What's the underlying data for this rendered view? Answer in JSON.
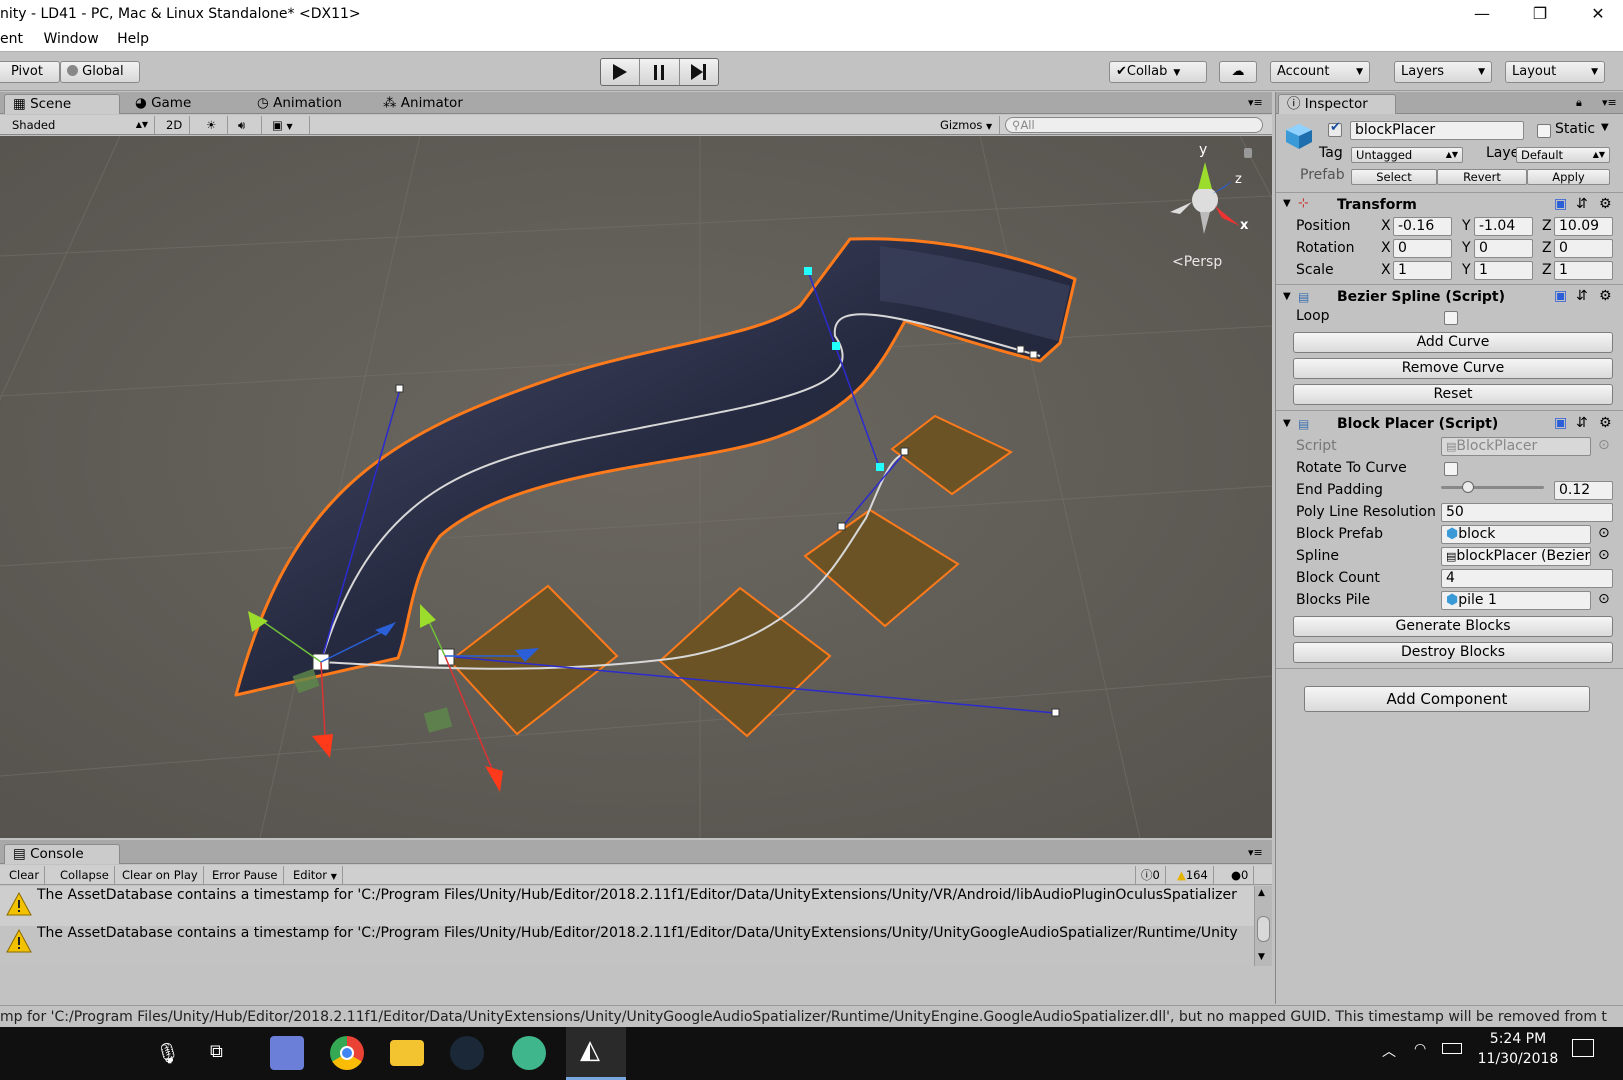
{
  "window": {
    "title": "nity - LD41 - PC, Mac & Linux Standalone* <DX11>",
    "minimize_glyph": "—",
    "maximize_glyph": "❐",
    "close_glyph": "✕"
  },
  "menu": [
    "ent",
    "Window",
    "Help"
  ],
  "toolbar": {
    "pivot": "Pivot",
    "global": "Global",
    "collab": "Collab",
    "account": "Account",
    "layers": "Layers",
    "layout": "Layout"
  },
  "scene_tabs": [
    {
      "label": "Scene",
      "icon": "grid-icon"
    },
    {
      "label": "Game",
      "icon": "game-icon"
    },
    {
      "label": "Animation",
      "icon": "clock-icon"
    },
    {
      "label": "Animator",
      "icon": "animator-icon"
    }
  ],
  "scene_toolbar": {
    "shading": "Shaded",
    "mode_2d": "2D",
    "gizmos": "Gizmos",
    "search_placeholder": "All"
  },
  "scene": {
    "gizmo_y": "y",
    "gizmo_z": "z",
    "gizmo_x": "x",
    "persp": "Persp"
  },
  "console": {
    "tab": "Console",
    "clear": "Clear",
    "collapse": "Collapse",
    "clear_on_play": "Clear on Play",
    "error_pause": "Error Pause",
    "editor": "Editor",
    "info_count": "0",
    "warn_count": "164",
    "error_count": "0",
    "logs": [
      "The AssetDatabase contains a timestamp for 'C:/Program Files/Unity/Hub/Editor/2018.2.11f1/Editor/Data/UnityExtensions/Unity/VR/Android/libAudioPluginOculusSpatializer",
      "The AssetDatabase contains a timestamp for 'C:/Program Files/Unity/Hub/Editor/2018.2.11f1/Editor/Data/UnityExtensions/Unity/UnityGoogleAudioSpatializer/Runtime/Unity"
    ],
    "status": "mp for 'C:/Program Files/Unity/Hub/Editor/2018.2.11f1/Editor/Data/UnityExtensions/Unity/UnityGoogleAudioSpatializer/Runtime/UnityEngine.GoogleAudioSpatializer.dll', but no mapped GUID. This timestamp will be removed from t"
  },
  "inspector": {
    "tab": "Inspector",
    "object_name": "blockPlacer",
    "static_label": "Static",
    "tag_label": "Tag",
    "tag_value": "Untagged",
    "layer_label": "Layer",
    "layer_value": "Default",
    "prefab_label": "Prefab",
    "select": "Select",
    "revert": "Revert",
    "apply": "Apply",
    "transform": {
      "title": "Transform",
      "position_label": "Position",
      "rotation_label": "Rotation",
      "scale_label": "Scale",
      "axis_x": "X",
      "axis_y": "Y",
      "axis_z": "Z",
      "position": [
        "-0.16",
        "-1.04",
        "10.09"
      ],
      "rotation": [
        "0",
        "0",
        "0"
      ],
      "scale": [
        "1",
        "1",
        "1"
      ]
    },
    "bezier": {
      "title": "Bezier Spline (Script)",
      "loop_label": "Loop",
      "add_curve": "Add Curve",
      "remove_curve": "Remove Curve",
      "reset": "Reset"
    },
    "block_placer": {
      "title": "Block Placer (Script)",
      "script_label": "Script",
      "script_value": "BlockPlacer",
      "rotate_label": "Rotate To Curve",
      "end_padding_label": "End Padding",
      "end_padding_value": "0.12",
      "end_padding_fraction": 0.12,
      "poly_label": "Poly Line Resolution",
      "poly_value": "50",
      "prefab_label": "Block Prefab",
      "prefab_value": "block",
      "spline_label": "Spline",
      "spline_value": "blockPlacer (Bezier",
      "count_label": "Block Count",
      "count_value": "4",
      "pile_label": "Blocks Pile",
      "pile_value": "pile 1",
      "generate": "Generate Blocks",
      "destroy": "Destroy Blocks"
    },
    "add_component": "Add Component"
  },
  "taskbar": {
    "time": "5:24 PM",
    "date": "11/30/2018"
  }
}
